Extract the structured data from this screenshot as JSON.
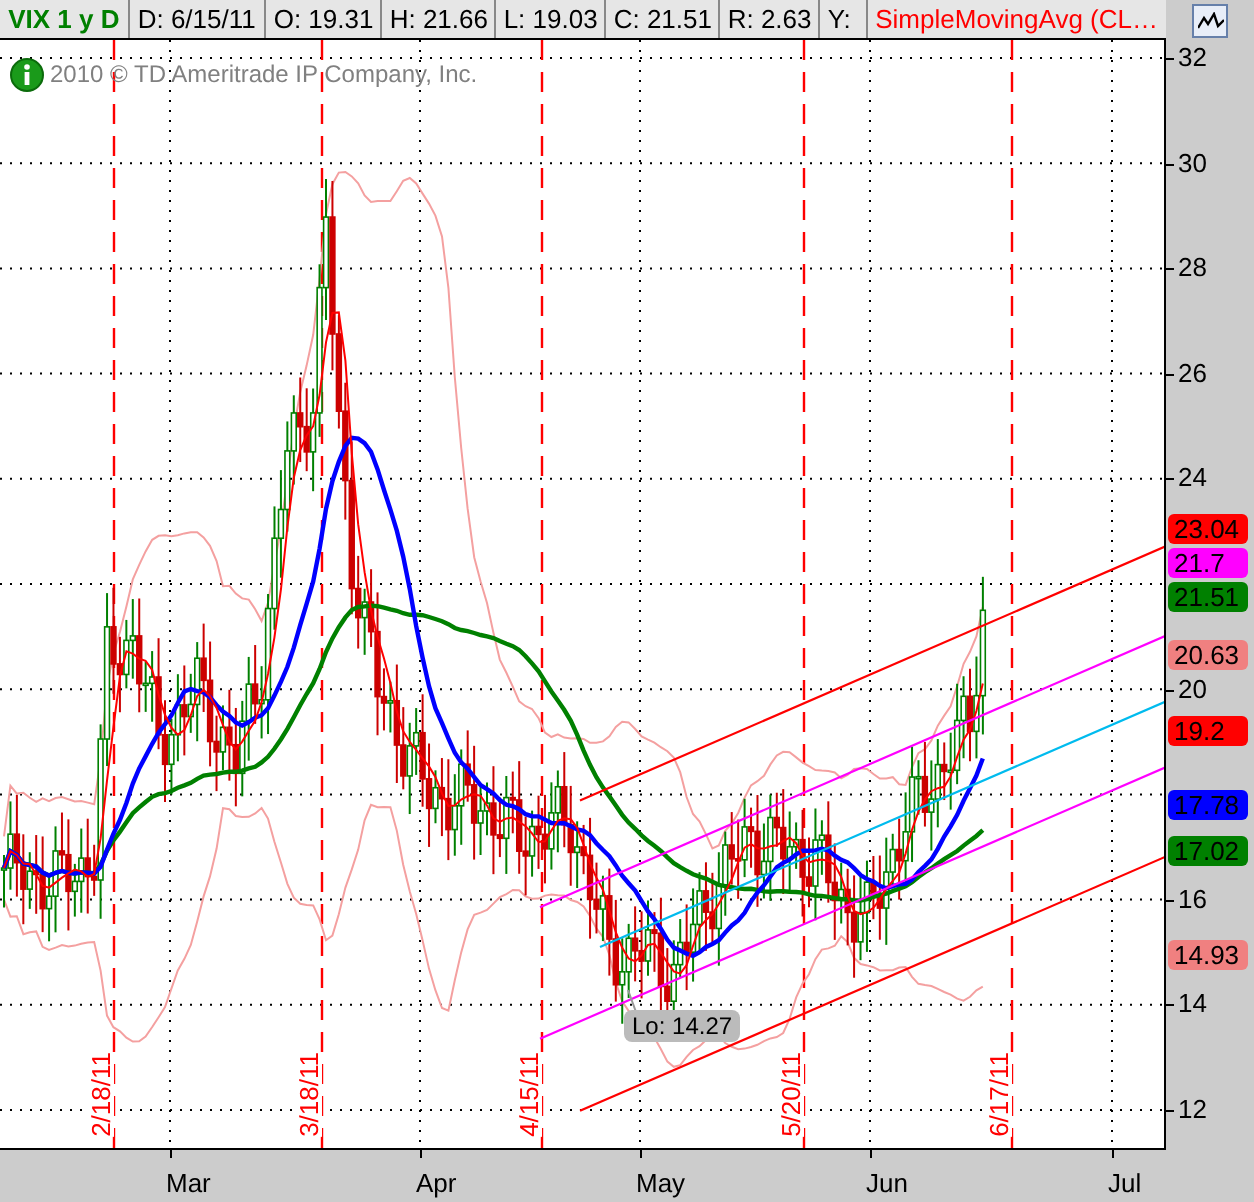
{
  "header": {
    "symbol": "VIX 1 y D",
    "fields": [
      "D: 6/15/11",
      "O: 19.31",
      "H: 21.66",
      "L: 19.03",
      "C: 21.51",
      "R: 2.63",
      "Y:"
    ],
    "study": "SimpleMovingAvg (CL…"
  },
  "copyright": "2010 © TD Ameritrade IP Company, Inc.",
  "y_axis": {
    "ticks": [
      "32",
      "30",
      "28",
      "26",
      "24",
      "20",
      "16",
      "14",
      "12"
    ]
  },
  "x_axis": {
    "months": [
      "Mar",
      "Apr",
      "May",
      "Jun",
      "Jul"
    ]
  },
  "date_markers": [
    "2/18/11",
    "3/18/11",
    "4/15/11",
    "5/20/11",
    "6/17/11"
  ],
  "price_tags": [
    {
      "text": "23.04",
      "color": "#ff0000"
    },
    {
      "text": "21.7",
      "color": "#ff00ff"
    },
    {
      "text": "21.51",
      "color": "#008000"
    },
    {
      "text": "20.63",
      "color": "#f08080"
    },
    {
      "text": "19.2",
      "color": "#ff0000"
    },
    {
      "text": "17.78",
      "color": "#0000ff"
    },
    {
      "text": "17.02",
      "color": "#008000"
    },
    {
      "text": "14.93",
      "color": "#f08080"
    }
  ],
  "low_label": "Lo: 14.27"
}
